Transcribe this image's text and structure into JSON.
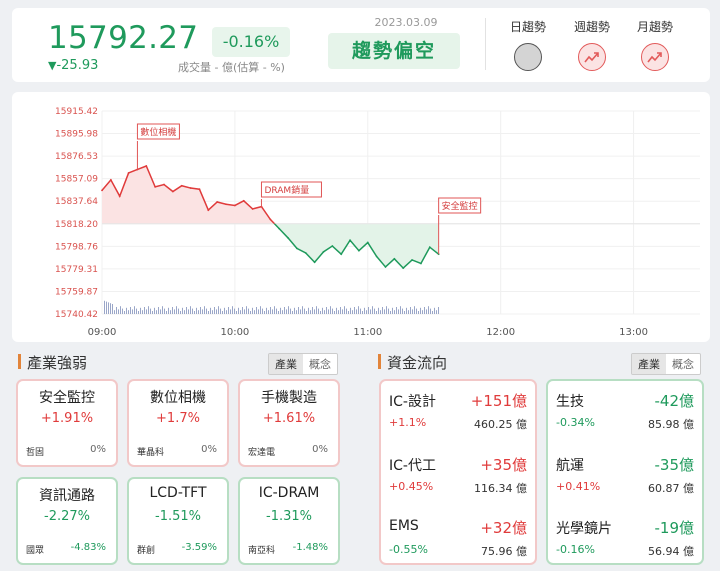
{
  "header": {
    "price": "15792.27",
    "change_pct": "-0.16%",
    "change": "-25.93",
    "change_arrow": "▼",
    "volume_label": "成交量 - 億(估算 - %)",
    "date": "2023.03.09",
    "trend_label": "趨勢偏空",
    "trends": [
      {
        "label": "日趨勢",
        "state": "neutral"
      },
      {
        "label": "週趨勢",
        "state": "up"
      },
      {
        "label": "月趨勢",
        "state": "up"
      }
    ]
  },
  "chart_data": {
    "type": "line",
    "title": "",
    "xlabel": "",
    "ylabel": "",
    "reference": 15818.2,
    "ylim": [
      15740.42,
      15915.42
    ],
    "y_ticks": [
      "15915.42",
      "15895.98",
      "15876.53",
      "15857.09",
      "15837.64",
      "15818.20",
      "15798.76",
      "15779.31",
      "15759.87",
      "15740.42"
    ],
    "x_ticks": [
      "09:00",
      "10:00",
      "11:00",
      "12:00",
      "13:00"
    ],
    "x_range": [
      "09:00",
      "13:30"
    ],
    "series": [
      {
        "x": [
          "09:00",
          "09:04",
          "09:08",
          "09:12",
          "09:16",
          "09:20",
          "09:24",
          "09:28",
          "09:32",
          "09:36",
          "09:40",
          "09:44",
          "09:48",
          "09:52",
          "09:56",
          "10:00",
          "10:04",
          "10:08",
          "10:12",
          "10:16",
          "10:20",
          "10:24",
          "10:28",
          "10:32",
          "10:36",
          "10:40",
          "10:44",
          "10:48",
          "10:52",
          "10:56",
          "11:00",
          "11:04",
          "11:08",
          "11:12",
          "11:16",
          "11:20",
          "11:24",
          "11:28",
          "11:32"
        ],
        "values": [
          15847,
          15856,
          15842,
          15862,
          15865,
          15868,
          15850,
          15852,
          15846,
          15851,
          15849,
          15848,
          15830,
          15837,
          15835,
          15834,
          15838,
          15831,
          15833,
          15822,
          15814,
          15806,
          15797,
          15793,
          15785,
          15794,
          15799,
          15792,
          15804,
          15795,
          15802,
          15790,
          15781,
          15788,
          15780,
          15787,
          15784,
          15798,
          15792
        ]
      }
    ],
    "annotations": [
      {
        "text": "數位相機",
        "x": "09:16"
      },
      {
        "text": "DRAM銷量",
        "x": "10:12"
      },
      {
        "text": "安全監控",
        "x": "11:32"
      }
    ],
    "grid": true
  },
  "industry": {
    "title": "產業強弱",
    "tabs": [
      "產業",
      "概念"
    ],
    "items": [
      {
        "name": "安全監控",
        "pct": "+1.91%",
        "stock": "哲固",
        "stock_pct": "0%",
        "dir": "up"
      },
      {
        "name": "數位相機",
        "pct": "+1.7%",
        "stock": "華晶科",
        "stock_pct": "0%",
        "dir": "up"
      },
      {
        "name": "手機製造",
        "pct": "+1.61%",
        "stock": "宏達電",
        "stock_pct": "0%",
        "dir": "up"
      },
      {
        "name": "資訊通路",
        "pct": "-2.27%",
        "stock": "國眾",
        "stock_pct": "-4.83%",
        "dir": "down"
      },
      {
        "name": "LCD-TFT",
        "pct": "-1.51%",
        "stock": "群創",
        "stock_pct": "-3.59%",
        "dir": "down"
      },
      {
        "name": "IC-DRAM",
        "pct": "-1.31%",
        "stock": "南亞科",
        "stock_pct": "-1.48%",
        "dir": "down"
      }
    ]
  },
  "fund": {
    "title": "資金流向",
    "tabs": [
      "產業",
      "概念"
    ],
    "inflow": [
      {
        "name": "IC-設計",
        "amount": "+151億",
        "pct": "+1.1%",
        "value": "460.25 億"
      },
      {
        "name": "IC-代工",
        "amount": "+35億",
        "pct": "+0.45%",
        "value": "116.34 億"
      },
      {
        "name": "EMS",
        "amount": "+32億",
        "pct": "-0.55%",
        "value": "75.96 億"
      }
    ],
    "outflow": [
      {
        "name": "生技",
        "amount": "-42億",
        "pct": "-0.34%",
        "value": "85.98 億"
      },
      {
        "name": "航運",
        "amount": "-35億",
        "pct": "+0.41%",
        "value": "60.87 億"
      },
      {
        "name": "光學鏡片",
        "amount": "-19億",
        "pct": "-0.16%",
        "value": "56.94 億"
      }
    ]
  },
  "colors": {
    "up": "#e03b3b",
    "down": "#1f9a5c",
    "accent": "#e2843a"
  }
}
